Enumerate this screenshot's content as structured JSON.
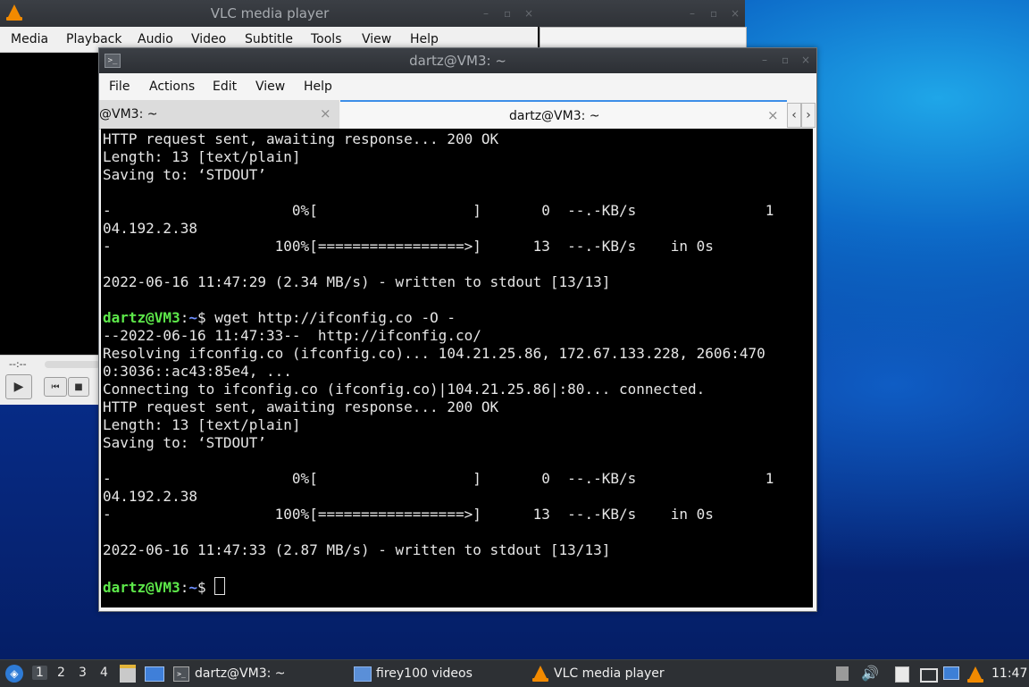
{
  "vlc": {
    "title": "VLC media player",
    "menu": [
      "Media",
      "Playback",
      "Audio",
      "Video",
      "Subtitle",
      "Tools",
      "View",
      "Help"
    ],
    "time_elapsed": "--:--"
  },
  "terminal": {
    "title": "dartz@VM3: ~",
    "menu": [
      "File",
      "Actions",
      "Edit",
      "View",
      "Help"
    ],
    "tabs": [
      {
        "label": "@VM3: ~"
      },
      {
        "label": "dartz@VM3: ~"
      }
    ],
    "prompt_user": "dartz@VM3",
    "prompt_path": "~",
    "lines_block1": "HTTP request sent, awaiting response... 200 OK\nLength: 13 [text/plain]\nSaving to: ‘STDOUT’\n\n-                     0%[                  ]       0  --.-KB/s               1\n04.192.2.38\n-                   100%[=================>]      13  --.-KB/s    in 0s\n\n2022-06-16 11:47:29 (2.34 MB/s) - written to stdout [13/13]\n",
    "command": "$ wget http://ifconfig.co -O -",
    "lines_block2": "--2022-06-16 11:47:33--  http://ifconfig.co/\nResolving ifconfig.co (ifconfig.co)... 104.21.25.86, 172.67.133.228, 2606:470\n0:3036::ac43:85e4, ...\nConnecting to ifconfig.co (ifconfig.co)|104.21.25.86|:80... connected.\nHTTP request sent, awaiting response... 200 OK\nLength: 13 [text/plain]\nSaving to: ‘STDOUT’\n\n-                     0%[                  ]       0  --.-KB/s               1\n04.192.2.38\n-                   100%[=================>]      13  --.-KB/s    in 0s\n\n2022-06-16 11:47:33 (2.87 MB/s) - written to stdout [13/13]\n",
    "prompt_tail": "$ "
  },
  "taskbar": {
    "workspaces": [
      "1",
      "2",
      "3",
      "4"
    ],
    "tasks": [
      {
        "label": "dartz@VM3: ~",
        "icon": "terminal-icon"
      },
      {
        "label": "firey100 videos",
        "icon": "folder-icon"
      },
      {
        "label": "VLC media player",
        "icon": "vlc-icon"
      }
    ],
    "clock": "11:47"
  },
  "colors": {
    "prompt_user": "#5de84a",
    "prompt_path": "#6f8fff",
    "tab_accent": "#3d8ee8",
    "vlc_orange": "#f28a00"
  }
}
